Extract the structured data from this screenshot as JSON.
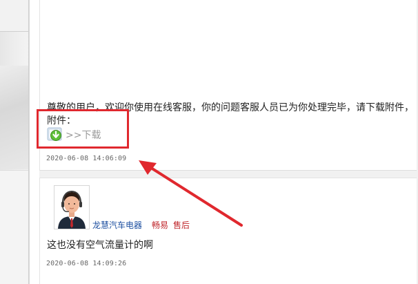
{
  "reply_message": {
    "text": "尊敬的用户，欢迎你使用在线客服，你的问题客服人员已为你处理完毕，请下载附件，",
    "attachment_label": "附件：",
    "download_link": ">>下载",
    "download_icon": "download-arrow-icon",
    "timestamp": "2020-06-08 14:06:09"
  },
  "user_message": {
    "avatar_icon": "support-agent-avatar",
    "sender_name": "龙慧汽车电器",
    "tags": [
      "畅易",
      "售后"
    ],
    "text": "这也没有空气流量计的啊",
    "timestamp": "2020-06-08 14:09:26"
  },
  "annotation": {
    "color": "#e0282e"
  },
  "colors": {
    "link_blue": "#1d4fa0",
    "tag_red": "#c0282d",
    "muted_link": "#9a9a9a",
    "timestamp": "#666666"
  }
}
